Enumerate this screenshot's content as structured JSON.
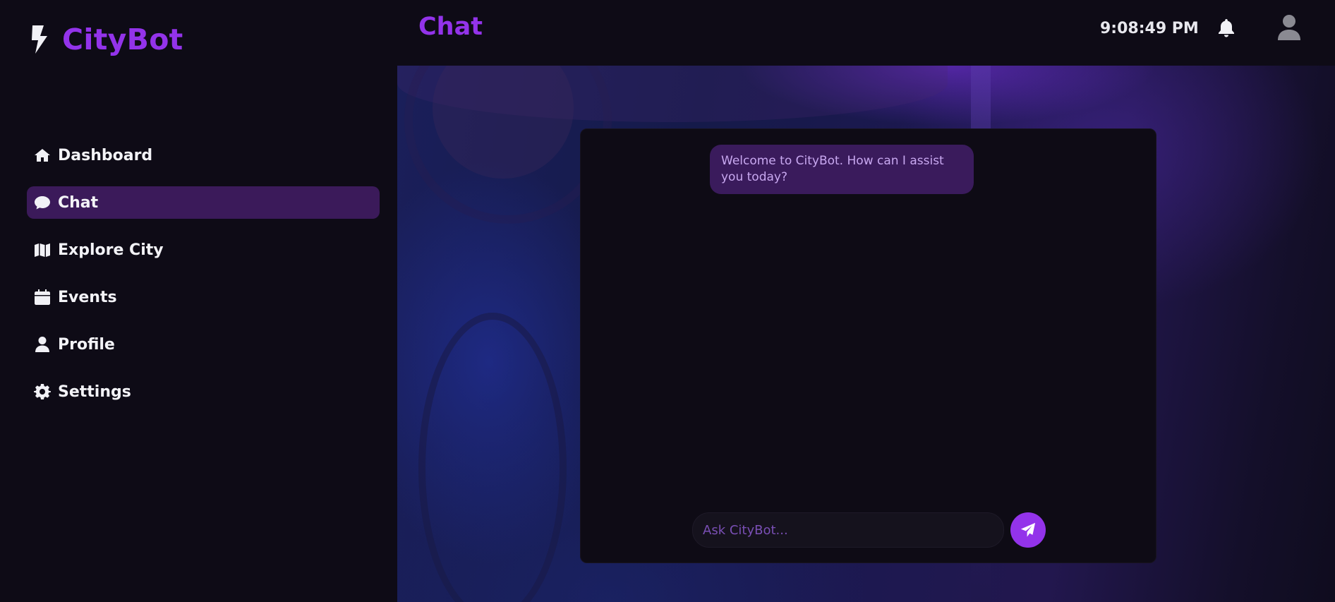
{
  "brand": {
    "name": "CityBot",
    "icon": "bolt-icon",
    "color": "#9333ea"
  },
  "nav": {
    "items": [
      {
        "label": "Dashboard",
        "icon": "home-icon"
      },
      {
        "label": "Chat",
        "icon": "chat-bubble-icon",
        "active": true
      },
      {
        "label": "Explore City",
        "icon": "map-icon"
      },
      {
        "label": "Events",
        "icon": "calendar-icon"
      },
      {
        "label": "Profile",
        "icon": "user-icon"
      },
      {
        "label": "Settings",
        "icon": "gear-icon"
      }
    ]
  },
  "header": {
    "title": "Chat",
    "clock": "9:08:49 PM",
    "notifications_icon": "bell-icon",
    "avatar_icon": "user-avatar-icon"
  },
  "chat": {
    "messages": [
      {
        "sender": "bot",
        "text": "Welcome to CityBot. How can I assist you today?"
      }
    ],
    "input": {
      "placeholder": "Ask CityBot...",
      "value": ""
    },
    "send_icon": "paper-plane-icon"
  },
  "colors": {
    "accent": "#9333ea",
    "active_nav_bg": "#3b1a5a",
    "bubble_bg": "#3a1b5c",
    "panel_bg": "#0e0b15"
  }
}
